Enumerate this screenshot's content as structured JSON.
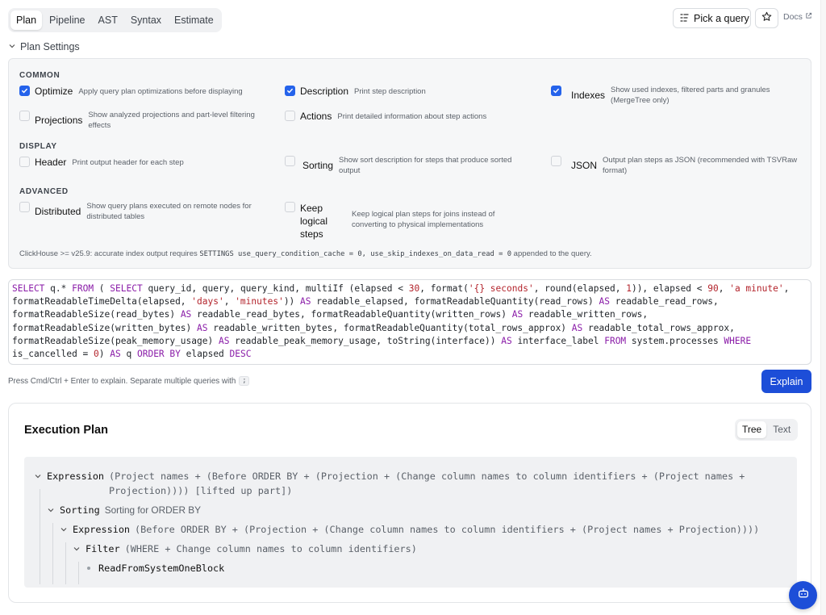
{
  "tabs": [
    {
      "label": "Plan",
      "active": true
    },
    {
      "label": "Pipeline",
      "active": false
    },
    {
      "label": "AST",
      "active": false
    },
    {
      "label": "Syntax",
      "active": false
    },
    {
      "label": "Estimate",
      "active": false
    }
  ],
  "header": {
    "pick_query_label": "Pick a query",
    "docs_label": "Docs"
  },
  "settings": {
    "toggle_label": "Plan Settings",
    "sections": {
      "common": "COMMON",
      "display": "DISPLAY",
      "advanced": "ADVANCED"
    },
    "options": {
      "optimize": {
        "label": "Optimize",
        "desc": "Apply query plan optimizations before displaying",
        "checked": true
      },
      "description": {
        "label": "Description",
        "desc": "Print step description",
        "checked": true
      },
      "indexes": {
        "label": "Indexes",
        "desc": "Show used indexes, filtered parts and granules (MergeTree only)",
        "checked": true
      },
      "projections": {
        "label": "Projections",
        "desc": "Show analyzed projections and part-level filtering effects",
        "checked": false
      },
      "actions": {
        "label": "Actions",
        "desc": "Print detailed information about step actions",
        "checked": false
      },
      "header": {
        "label": "Header",
        "desc": "Print output header for each step",
        "checked": false
      },
      "sorting": {
        "label": "Sorting",
        "desc": "Show sort description for steps that produce sorted output",
        "checked": false
      },
      "json": {
        "label": "JSON",
        "desc": "Output plan steps as JSON (recommended with TSVRaw format)",
        "checked": false
      },
      "distributed": {
        "label": "Distributed",
        "desc": "Show query plans executed on remote nodes for distributed tables",
        "checked": false
      },
      "keep_logical": {
        "label": "Keep logical steps",
        "desc": "Keep logical plan steps for joins instead of converting to physical implementations",
        "checked": false
      }
    },
    "note_prefix": "ClickHouse >= v25.9: accurate index output requires",
    "note_code": "SETTINGS use_query_condition_cache = 0, use_skip_indexes_on_data_read = 0",
    "note_suffix": "appended to the query."
  },
  "editor": {
    "query": "SELECT q.* FROM ( SELECT query_id, query, query_kind, multiIf (elapsed < 30, format('{} seconds', round(elapsed, 1)), elapsed < 90, 'a minute', formatReadableTimeDelta(elapsed, 'days', 'minutes')) AS readable_elapsed, formatReadableQuantity(read_rows) AS readable_read_rows, formatReadableSize(read_bytes) AS readable_read_bytes, formatReadableQuantity(written_rows) AS readable_written_rows, formatReadableSize(written_bytes) AS readable_written_bytes, formatReadableQuantity(total_rows_approx) AS readable_total_rows_approx, formatReadableSize(peak_memory_usage) AS readable_peak_memory_usage, toString(interface)) AS interface_label FROM system.processes WHERE is_cancelled = 0) AS q ORDER BY elapsed DESC"
  },
  "hint": {
    "text": "Press Cmd/Ctrl + Enter to explain. Separate multiple queries with",
    "key": ";"
  },
  "explain_label": "Explain",
  "plan": {
    "title": "Execution Plan",
    "views": [
      {
        "label": "Tree",
        "active": true
      },
      {
        "label": "Text",
        "active": false
      }
    ],
    "nodes": [
      {
        "name": "Expression",
        "desc": "(Project names + (Before ORDER BY + (Projection + (Change column names to column identifiers + (Project names + Projection)))) [lifted up part])"
      },
      {
        "name": "Sorting",
        "desc": "Sorting for ORDER BY"
      },
      {
        "name": "Expression",
        "desc": "(Before ORDER BY + (Projection + (Change column names to column identifiers + (Project names + Projection))))"
      },
      {
        "name": "Filter",
        "desc": "(WHERE + Change column names to column identifiers)"
      },
      {
        "name": "ReadFromSystemOneBlock",
        "desc": ""
      }
    ]
  },
  "colors": {
    "accent": "#1d4ed8",
    "checkbox_checked": "#2563eb",
    "keyword": "#8a1ca8",
    "string": "#b3242c"
  },
  "icons": [
    "list-filter-icon",
    "star-icon",
    "external-link-icon",
    "chevron-down-icon",
    "check-icon",
    "bot-icon"
  ]
}
